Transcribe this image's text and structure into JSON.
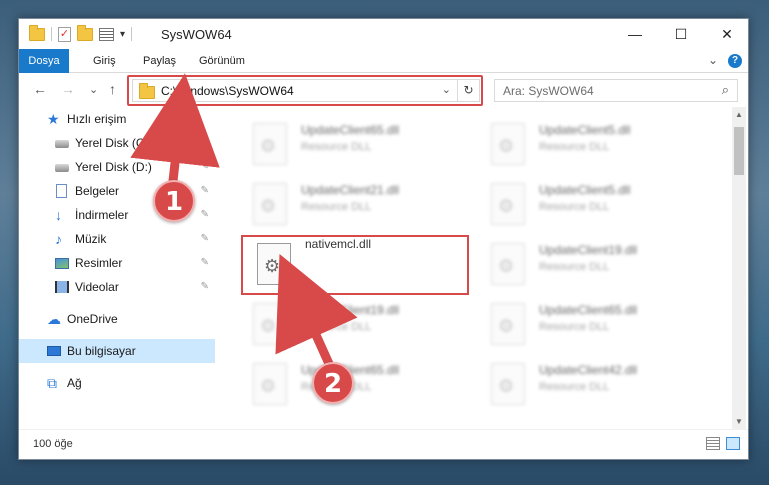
{
  "window": {
    "title": "SysWOW64",
    "minimize": "—",
    "maximize": "☐",
    "close": "✕",
    "qa_dropdown": "▾"
  },
  "ribbon": {
    "tabs": [
      "Dosya",
      "Giriş",
      "Paylaş",
      "Görünüm"
    ],
    "help": "?",
    "expand": "⌄"
  },
  "nav": {
    "back": "←",
    "forward": "→",
    "recent": "⌄",
    "up": "↑",
    "address": "C:\\Windows\\SysWOW64",
    "address_chevron": "⌄",
    "refresh": "↻",
    "search_placeholder": "Ara: SysWOW64",
    "search_icon": "⌕"
  },
  "sidebar": {
    "items": [
      {
        "label": "Hızlı erişim",
        "icon": "star-icon",
        "pinned": false
      },
      {
        "label": "Yerel Disk (C:)",
        "icon": "disk-icon",
        "pinned": true
      },
      {
        "label": "Yerel Disk (D:)",
        "icon": "disk-icon",
        "pinned": true
      },
      {
        "label": "Belgeler",
        "icon": "document-icon",
        "pinned": true
      },
      {
        "label": "İndirmeler",
        "icon": "download-icon",
        "pinned": true
      },
      {
        "label": "Müzik",
        "icon": "music-icon",
        "pinned": true
      },
      {
        "label": "Resimler",
        "icon": "pictures-icon",
        "pinned": true
      },
      {
        "label": "Videolar",
        "icon": "videos-icon",
        "pinned": true
      },
      {
        "label": "OneDrive",
        "icon": "cloud-icon",
        "pinned": false
      },
      {
        "label": "Bu bilgisayar",
        "icon": "computer-icon",
        "pinned": false
      },
      {
        "label": "Ağ",
        "icon": "network-icon",
        "pinned": false
      }
    ],
    "pin_glyph": "📌"
  },
  "files": [
    {
      "name": "UpdateClient65.dll",
      "type": "Resource DLL"
    },
    {
      "name": "UpdateClient5.dll",
      "type": "Resource DLL"
    },
    {
      "name": "UpdateClient21.dll",
      "type": "Resource DLL"
    },
    {
      "name": "UpdateClient5.dll",
      "type": "Resource DLL"
    },
    {
      "name": "nativemcl.dll",
      "type": ""
    },
    {
      "name": "UpdateClient19.dll",
      "type": "Resource DLL"
    },
    {
      "name": "UpdateClient19.dll",
      "type": "Resource DLL"
    },
    {
      "name": "UpdateClient65.dll",
      "type": "Resource DLL"
    },
    {
      "name": "UpdateClient65.dll",
      "type": "Resource DLL"
    },
    {
      "name": "UpdateClient42.dll",
      "type": "Resource DLL"
    }
  ],
  "status": {
    "count": "100 öğe"
  },
  "annotations": {
    "badge1": "1",
    "badge2": "2",
    "color": "#d84a4a"
  }
}
